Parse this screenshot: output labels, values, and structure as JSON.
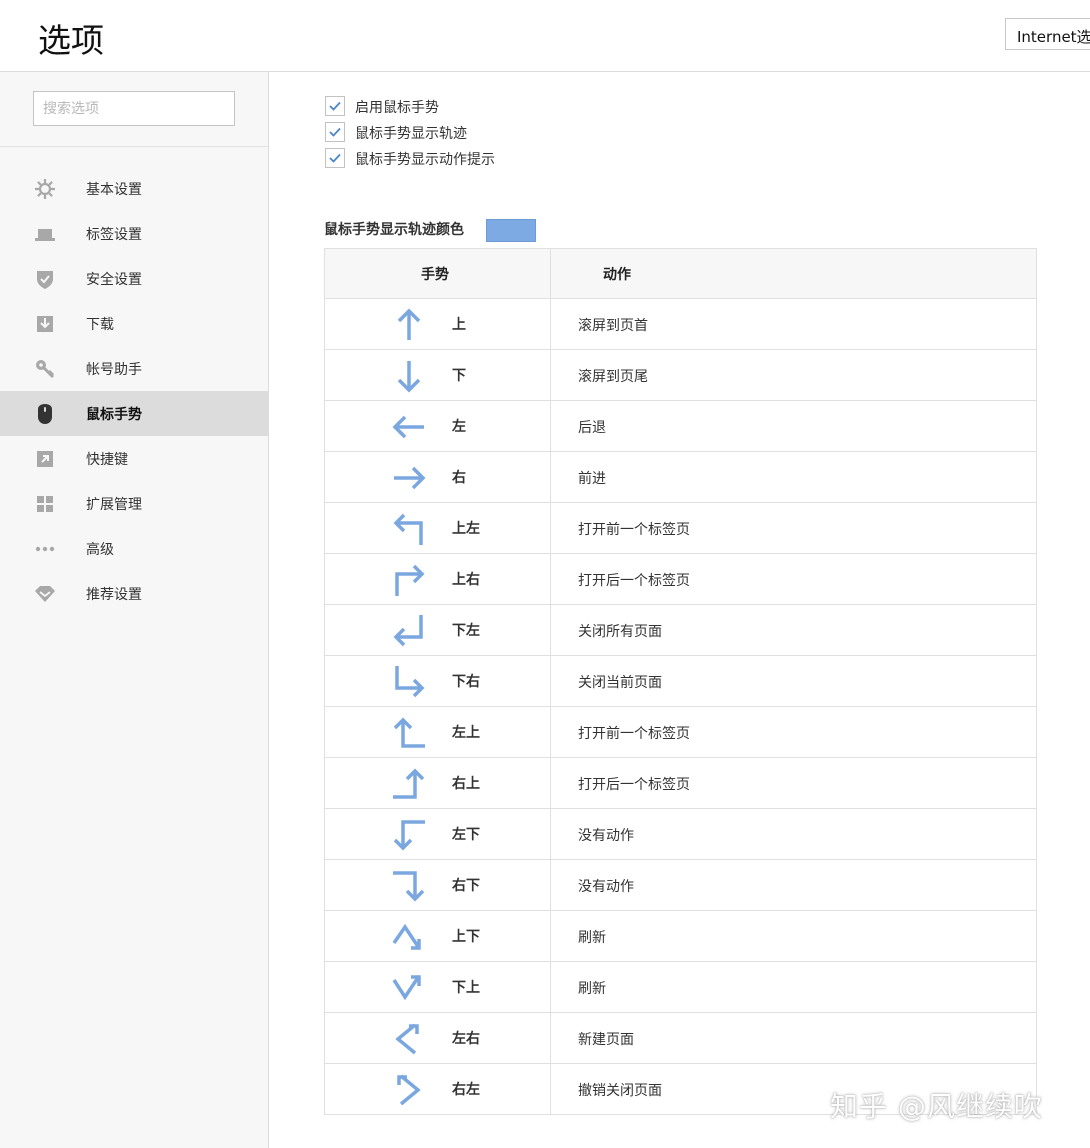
{
  "header": {
    "title": "选项",
    "ie_button_label": "Internet选"
  },
  "sidebar": {
    "search_placeholder": "搜索选项",
    "items": [
      {
        "label": "基本设置",
        "icon": "gear-icon",
        "active": false
      },
      {
        "label": "标签设置",
        "icon": "tab-icon",
        "active": false
      },
      {
        "label": "安全设置",
        "icon": "shield-icon",
        "active": false
      },
      {
        "label": "下载",
        "icon": "download-icon",
        "active": false
      },
      {
        "label": "帐号助手",
        "icon": "key-icon",
        "active": false
      },
      {
        "label": "鼠标手势",
        "icon": "mouse-icon",
        "active": true
      },
      {
        "label": "快捷键",
        "icon": "shortcut-icon",
        "active": false
      },
      {
        "label": "扩展管理",
        "icon": "extensions-icon",
        "active": false
      },
      {
        "label": "高级",
        "icon": "more-icon",
        "active": false
      },
      {
        "label": "推荐设置",
        "icon": "diamond-icon",
        "active": false
      }
    ]
  },
  "options": [
    {
      "label": "启用鼠标手势",
      "checked": true
    },
    {
      "label": "鼠标手势显示轨迹",
      "checked": true
    },
    {
      "label": "鼠标手势显示动作提示",
      "checked": true
    }
  ],
  "trail_color": {
    "label": "鼠标手势显示轨迹颜色",
    "value": "#7eaae3"
  },
  "table": {
    "headers": {
      "gesture": "手势",
      "action": "动作"
    },
    "rows": [
      {
        "gesture": "上",
        "action": "滚屏到页首",
        "icon": "arrow-up-icon"
      },
      {
        "gesture": "下",
        "action": "滚屏到页尾",
        "icon": "arrow-down-icon"
      },
      {
        "gesture": "左",
        "action": "后退",
        "icon": "arrow-left-icon"
      },
      {
        "gesture": "右",
        "action": "前进",
        "icon": "arrow-right-icon"
      },
      {
        "gesture": "上左",
        "action": "打开前一个标签页",
        "icon": "arrow-up-left-icon"
      },
      {
        "gesture": "上右",
        "action": "打开后一个标签页",
        "icon": "arrow-up-right-icon"
      },
      {
        "gesture": "下左",
        "action": "关闭所有页面",
        "icon": "arrow-down-left-icon"
      },
      {
        "gesture": "下右",
        "action": "关闭当前页面",
        "icon": "arrow-down-right-icon"
      },
      {
        "gesture": "左上",
        "action": "打开前一个标签页",
        "icon": "arrow-left-up-icon"
      },
      {
        "gesture": "右上",
        "action": "打开后一个标签页",
        "icon": "arrow-right-up-icon"
      },
      {
        "gesture": "左下",
        "action": "没有动作",
        "icon": "arrow-left-down-icon"
      },
      {
        "gesture": "右下",
        "action": "没有动作",
        "icon": "arrow-right-down-icon"
      },
      {
        "gesture": "上下",
        "action": "刷新",
        "icon": "arrow-up-down-icon"
      },
      {
        "gesture": "下上",
        "action": "刷新",
        "icon": "arrow-down-up-icon"
      },
      {
        "gesture": "左右",
        "action": "新建页面",
        "icon": "arrow-left-right-icon"
      },
      {
        "gesture": "右左",
        "action": "撤销关闭页面",
        "icon": "arrow-right-left-icon"
      }
    ]
  },
  "watermark": "知乎 @风继续吹",
  "colors": {
    "accent": "#7eaae3",
    "arrow": "#7aa7e0",
    "active_bg": "#dcdcdc"
  }
}
